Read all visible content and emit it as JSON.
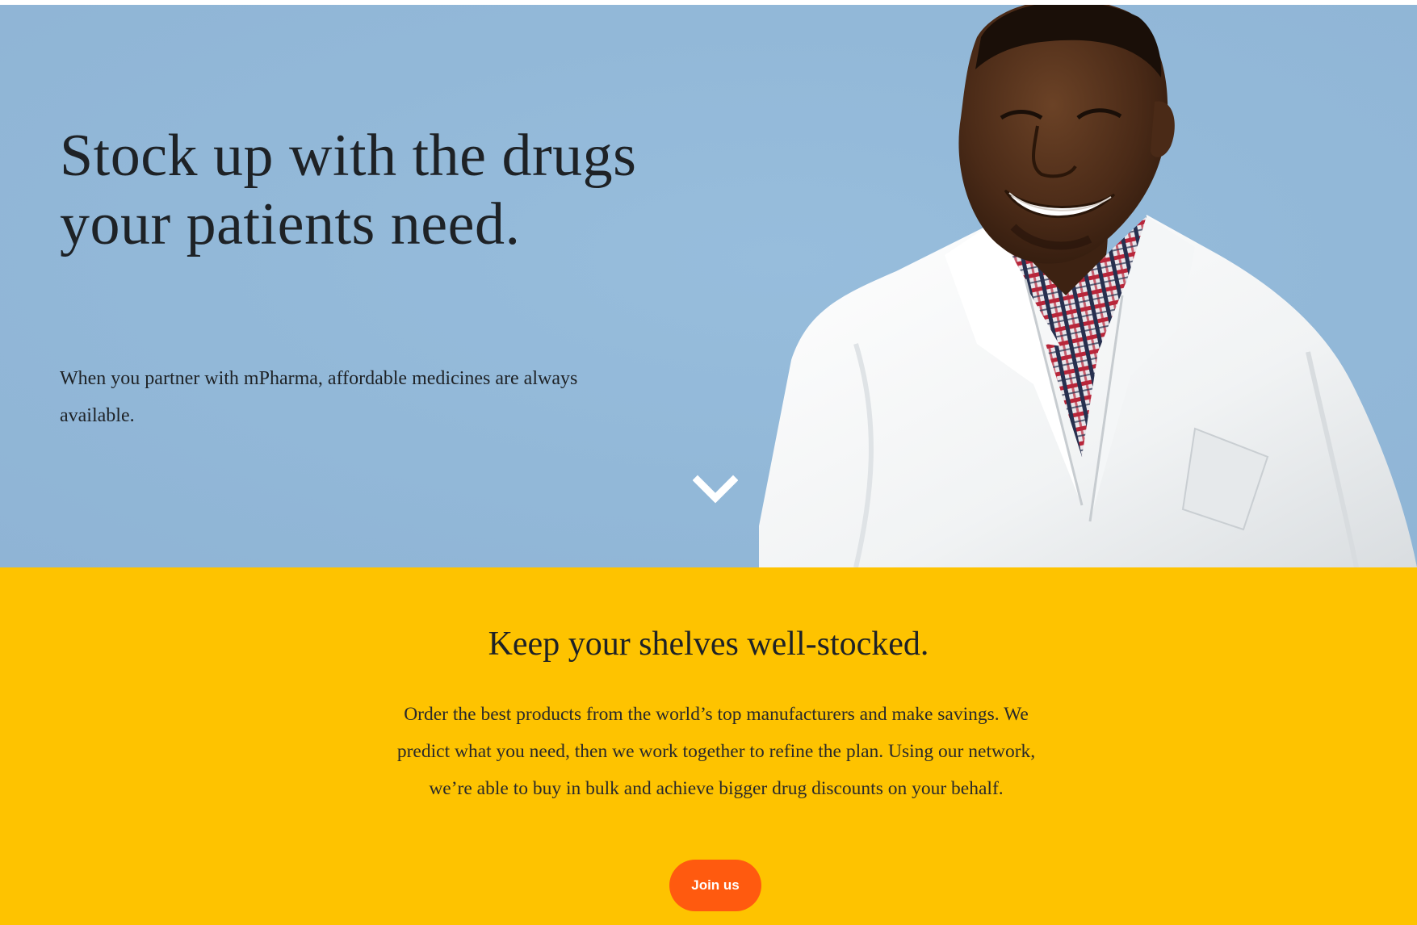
{
  "hero": {
    "title": "Stock up with the drugs your patients need.",
    "subtitle": "When you partner with mPharma, affordable medicines are always available.",
    "scroll_icon": "chevron-down-icon",
    "image": "smiling-pharmacist-in-white-coat"
  },
  "promo": {
    "title": "Keep your shelves well-stocked.",
    "body": "Order the best products from the world’s top manufacturers and make savings. We predict what you need, then we work together to refine the plan. Using our network, we’re able to buy in bulk and achieve bigger drug discounts on your behalf.",
    "button_label": "Join us"
  },
  "colors": {
    "hero_background": "#92b8d8",
    "promo_background": "#fec300",
    "button": "#ff5a0f",
    "text": "#1e2226"
  }
}
